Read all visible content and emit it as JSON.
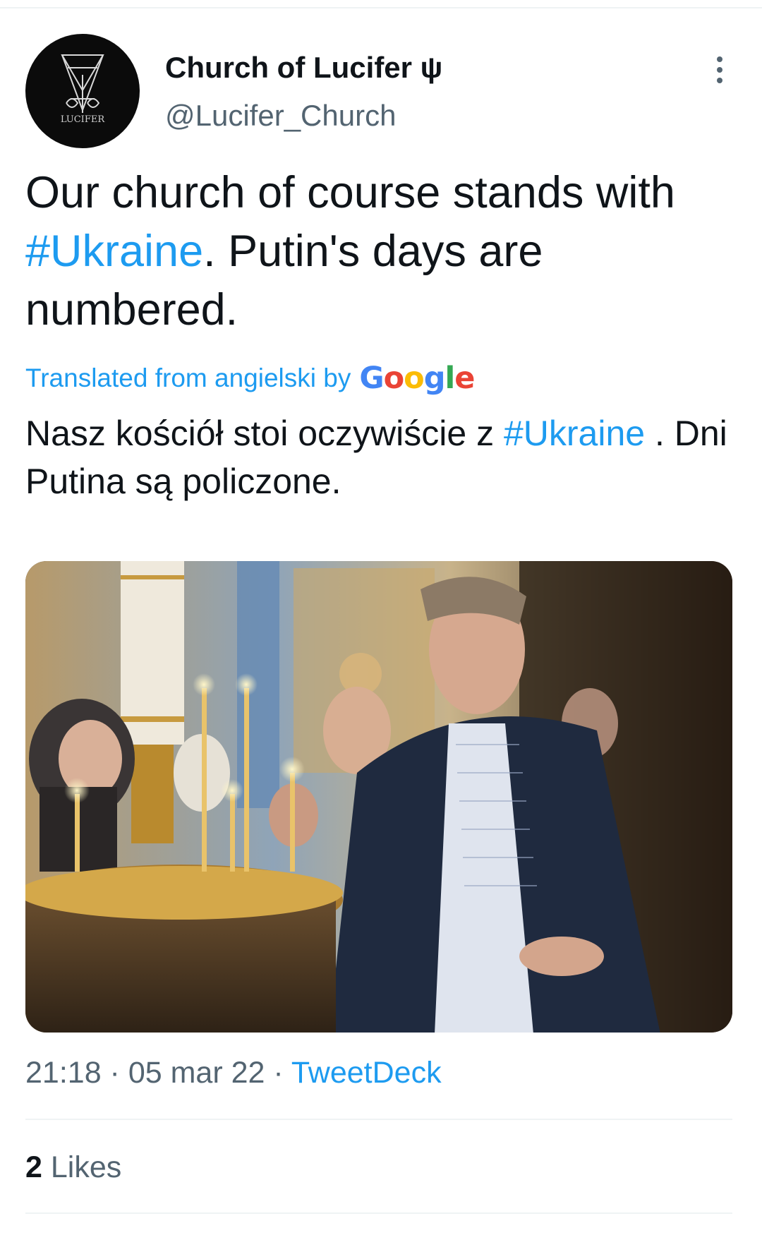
{
  "author": {
    "display_name": "Church of Lucifer ψ",
    "handle": "@Lucifer_Church",
    "avatar_text": "LUCIFER",
    "avatar_icon": "sigil-icon"
  },
  "tweet": {
    "text_part1": "Our church of course stands with ",
    "hashtag": "#Ukraine",
    "text_part2": ". Putin's days are numbered."
  },
  "translation": {
    "label": "Translated from angielski by",
    "provider": "Google",
    "text_part1": "Nasz kościół stoi oczywiście z ",
    "hashtag": "#Ukraine",
    "text_part2": " . Dni Putina są policzone."
  },
  "media": {
    "type": "photo"
  },
  "meta": {
    "time": "21:18",
    "separator1": " · ",
    "date": "05 mar 22",
    "separator2": " · ",
    "source": "TweetDeck"
  },
  "engagement": {
    "likes_count": "2",
    "likes_label": " Likes"
  },
  "colors": {
    "link": "#1d9bf0",
    "text": "#0f1419",
    "secondary": "#536471",
    "divider": "#eff3f4"
  }
}
